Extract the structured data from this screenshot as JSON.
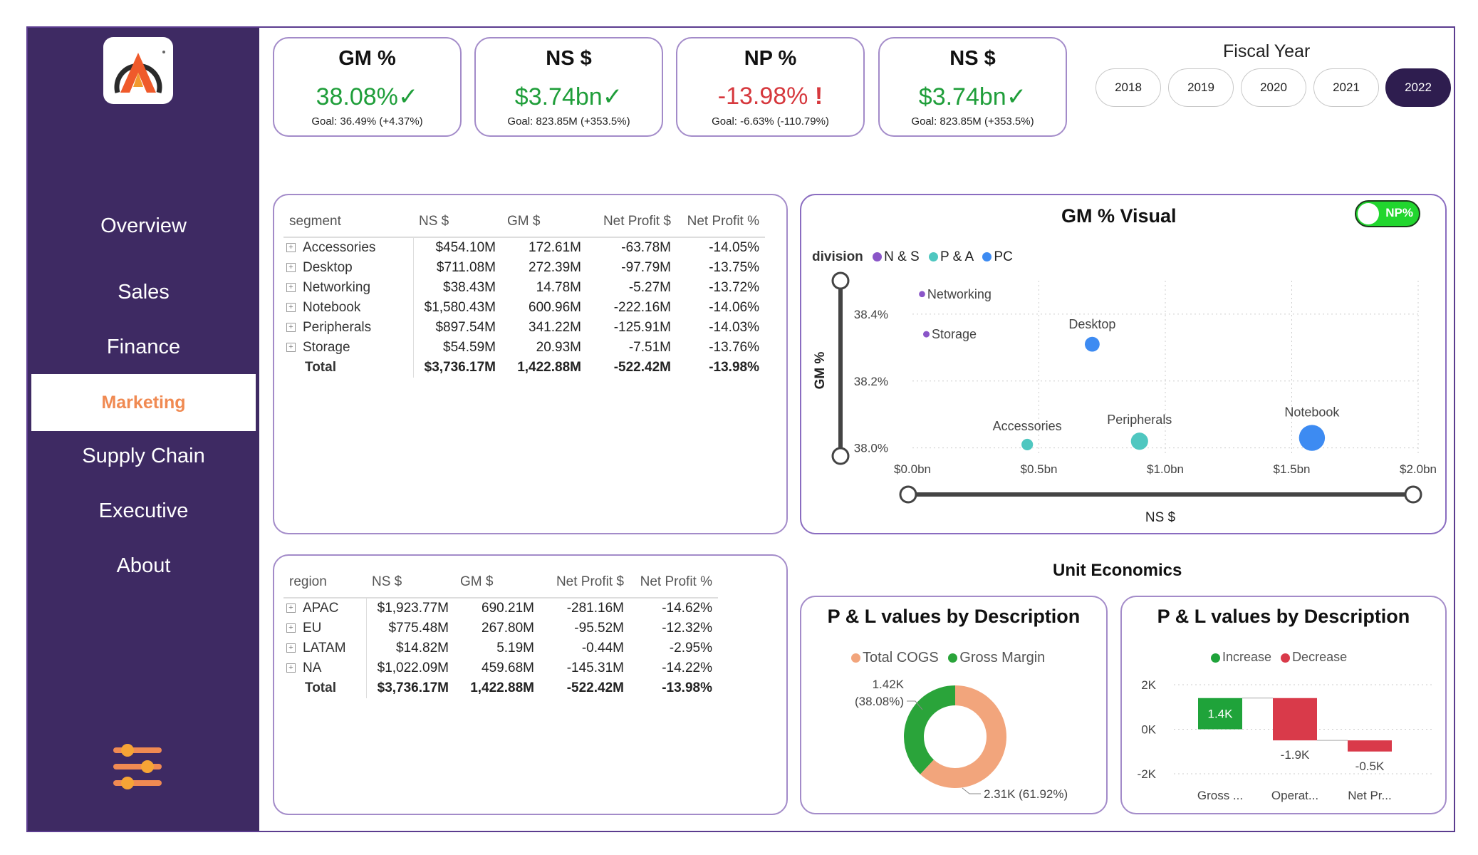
{
  "sidebar": {
    "items": [
      {
        "label": "Overview"
      },
      {
        "label": "Sales"
      },
      {
        "label": "Finance"
      },
      {
        "label": "Marketing"
      },
      {
        "label": "Supply Chain"
      },
      {
        "label": "Executive"
      },
      {
        "label": "About"
      }
    ],
    "active": "Marketing"
  },
  "kpis": [
    {
      "title": "GM %",
      "value": "38.08%",
      "status": "up",
      "goal": "Goal: 36.49% (+4.37%)"
    },
    {
      "title": "NS $",
      "value": "$3.74bn",
      "status": "up",
      "goal": "Goal: 823.85M (+353.5%)"
    },
    {
      "title": "NP %",
      "value": "-13.98%",
      "status": "alert",
      "goal": "Goal: -6.63% (-110.79%)"
    },
    {
      "title": "NS $",
      "value": "$3.74bn",
      "status": "up",
      "goal": "Goal: 823.85M (+353.5%)"
    }
  ],
  "fiscal_year": {
    "title": "Fiscal Year",
    "options": [
      "2018",
      "2019",
      "2020",
      "2021",
      "2022"
    ],
    "selected": "2022"
  },
  "segment_table": {
    "headers": [
      "segment",
      "NS $",
      "GM $",
      "Net Profit $",
      "Net Profit %"
    ],
    "rows": [
      [
        "Accessories",
        "$454.10M",
        "172.61M",
        "-63.78M",
        "-14.05%"
      ],
      [
        "Desktop",
        "$711.08M",
        "272.39M",
        "-97.79M",
        "-13.75%"
      ],
      [
        "Networking",
        "$38.43M",
        "14.78M",
        "-5.27M",
        "-13.72%"
      ],
      [
        "Notebook",
        "$1,580.43M",
        "600.96M",
        "-222.16M",
        "-14.06%"
      ],
      [
        "Peripherals",
        "$897.54M",
        "341.22M",
        "-125.91M",
        "-14.03%"
      ],
      [
        "Storage",
        "$54.59M",
        "20.93M",
        "-7.51M",
        "-13.76%"
      ]
    ],
    "total": [
      "Total",
      "$3,736.17M",
      "1,422.88M",
      "-522.42M",
      "-13.98%"
    ]
  },
  "region_table": {
    "headers": [
      "region",
      "NS $",
      "GM $",
      "Net Profit $",
      "Net Profit %"
    ],
    "rows": [
      [
        "APAC",
        "$1,923.77M",
        "690.21M",
        "-281.16M",
        "-14.62%"
      ],
      [
        "EU",
        "$775.48M",
        "267.80M",
        "-95.52M",
        "-12.32%"
      ],
      [
        "LATAM",
        "$14.82M",
        "5.19M",
        "-0.44M",
        "-2.95%"
      ],
      [
        "NA",
        "$1,022.09M",
        "459.68M",
        "-145.31M",
        "-14.22%"
      ]
    ],
    "total": [
      "Total",
      "$3,736.17M",
      "1,422.88M",
      "-522.42M",
      "-13.98%"
    ]
  },
  "gm_visual": {
    "title": "GM % Visual",
    "toggle_label": "NP%",
    "legend_title": "division",
    "legend": [
      {
        "name": "N & S",
        "color": "#8a55c8"
      },
      {
        "name": "P & A",
        "color": "#4fc7c0"
      },
      {
        "name": "PC",
        "color": "#3d8bf2"
      }
    ],
    "ylabel": "GM %",
    "xlabel": "NS $",
    "yticks": [
      "38.4%",
      "38.2%",
      "38.0%"
    ],
    "xticks": [
      "$0.0bn",
      "$0.5bn",
      "$1.0bn",
      "$1.5bn",
      "$2.0bn"
    ],
    "points": [
      {
        "label": "Networking",
        "division": "N & S"
      },
      {
        "label": "Storage",
        "division": "N & S"
      },
      {
        "label": "Desktop",
        "division": "PC"
      },
      {
        "label": "Accessories",
        "division": "P & A"
      },
      {
        "label": "Peripherals",
        "division": "P & A"
      },
      {
        "label": "Notebook",
        "division": "PC"
      }
    ]
  },
  "unit_economics": {
    "title": "Unit Economics"
  },
  "donut": {
    "title": "P & L values by Description",
    "legend": [
      {
        "name": "Total COGS",
        "color": "#f2a57c"
      },
      {
        "name": "Gross Margin",
        "color": "#2aa43a"
      }
    ],
    "label_gm_value": "1.42K",
    "label_gm_pct": "(38.08%)",
    "label_cogs": "2.31K (61.92%)"
  },
  "waterfall": {
    "title": "P & L values by Description",
    "legend": [
      {
        "name": "Increase",
        "color": "#1fa33a"
      },
      {
        "name": "Decrease",
        "color": "#d93a4a"
      }
    ],
    "yticks": [
      "2K",
      "0K",
      "-2K"
    ],
    "bars": [
      {
        "category": "Gross ...",
        "label": "1.4K"
      },
      {
        "category": "Operat...",
        "label": "-1.9K"
      },
      {
        "category": "Net Pr...",
        "label": "-0.5K"
      }
    ]
  },
  "chart_data": [
    {
      "type": "scatter",
      "title": "GM % Visual",
      "xlabel": "NS $",
      "ylabel": "GM %",
      "xlim": [
        0,
        2.0
      ],
      "ylim": [
        37.98,
        38.5
      ],
      "x_unit": "bn",
      "points": [
        {
          "label": "Networking",
          "division": "N & S",
          "x": 0.038,
          "y": 38.46
        },
        {
          "label": "Storage",
          "division": "N & S",
          "x": 0.055,
          "y": 38.34
        },
        {
          "label": "Desktop",
          "division": "PC",
          "x": 0.711,
          "y": 38.31
        },
        {
          "label": "Accessories",
          "division": "P & A",
          "x": 0.454,
          "y": 38.01
        },
        {
          "label": "Peripherals",
          "division": "P & A",
          "x": 0.898,
          "y": 38.02
        },
        {
          "label": "Notebook",
          "division": "PC",
          "x": 1.58,
          "y": 38.03
        }
      ]
    },
    {
      "type": "pie",
      "title": "P & L values by Description",
      "labels": [
        "Gross Margin",
        "Total COGS"
      ],
      "values": [
        1.42,
        2.31
      ],
      "percent": [
        38.08,
        61.92
      ]
    },
    {
      "type": "bar",
      "title": "P & L values by Description",
      "categories": [
        "Gross ...",
        "Operat...",
        "Net Pr..."
      ],
      "values": [
        1.4,
        -1.9,
        -0.5
      ],
      "ylim": [
        -2,
        2
      ]
    }
  ]
}
